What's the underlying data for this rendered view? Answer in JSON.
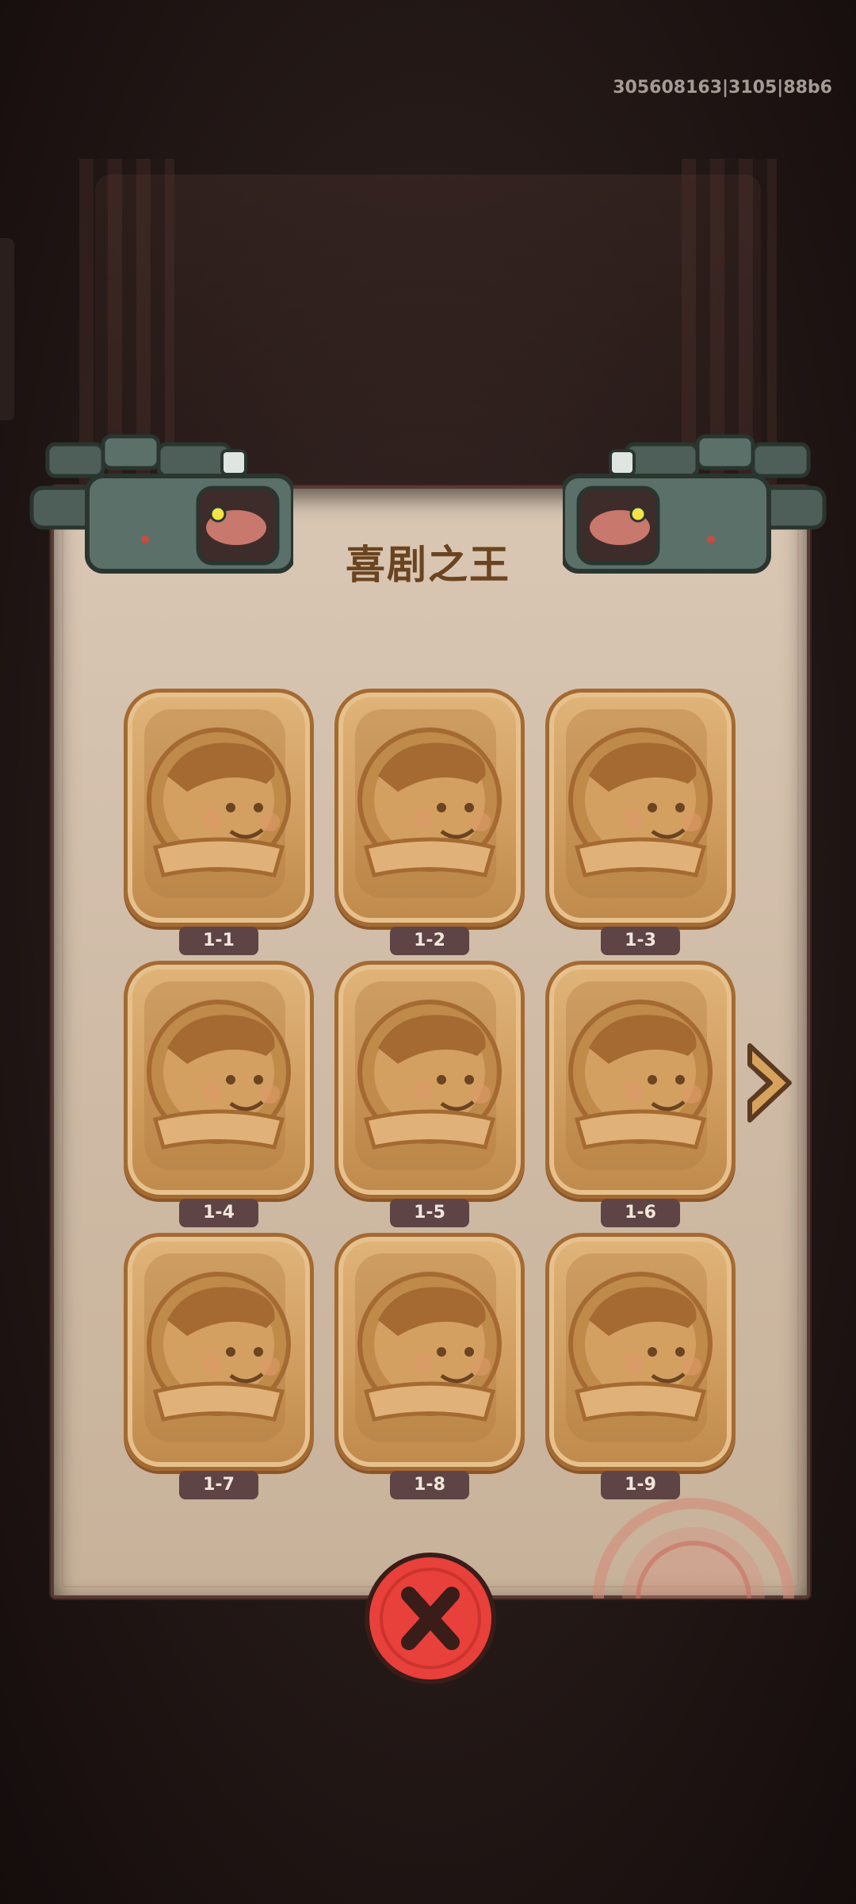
{
  "debug": {
    "code": "305608163|3105|88b6"
  },
  "panel": {
    "title": "喜剧之王"
  },
  "levels": [
    {
      "label": "1-1"
    },
    {
      "label": "1-2"
    },
    {
      "label": "1-3"
    },
    {
      "label": "1-4"
    },
    {
      "label": "1-5"
    },
    {
      "label": "1-6"
    },
    {
      "label": "1-7"
    },
    {
      "label": "1-8"
    },
    {
      "label": "1-9"
    }
  ],
  "icons": {
    "camera": "camera-icon",
    "next": "arrow-right-icon",
    "close": "close-icon",
    "portrait": "character-portrait-icon",
    "seal": "stamp-icon"
  },
  "colors": {
    "panel": "#d9c7b4",
    "card": "#d7a66a",
    "label_bg": "#5e4444",
    "close": "#e8403a",
    "title": "#6a4420"
  }
}
